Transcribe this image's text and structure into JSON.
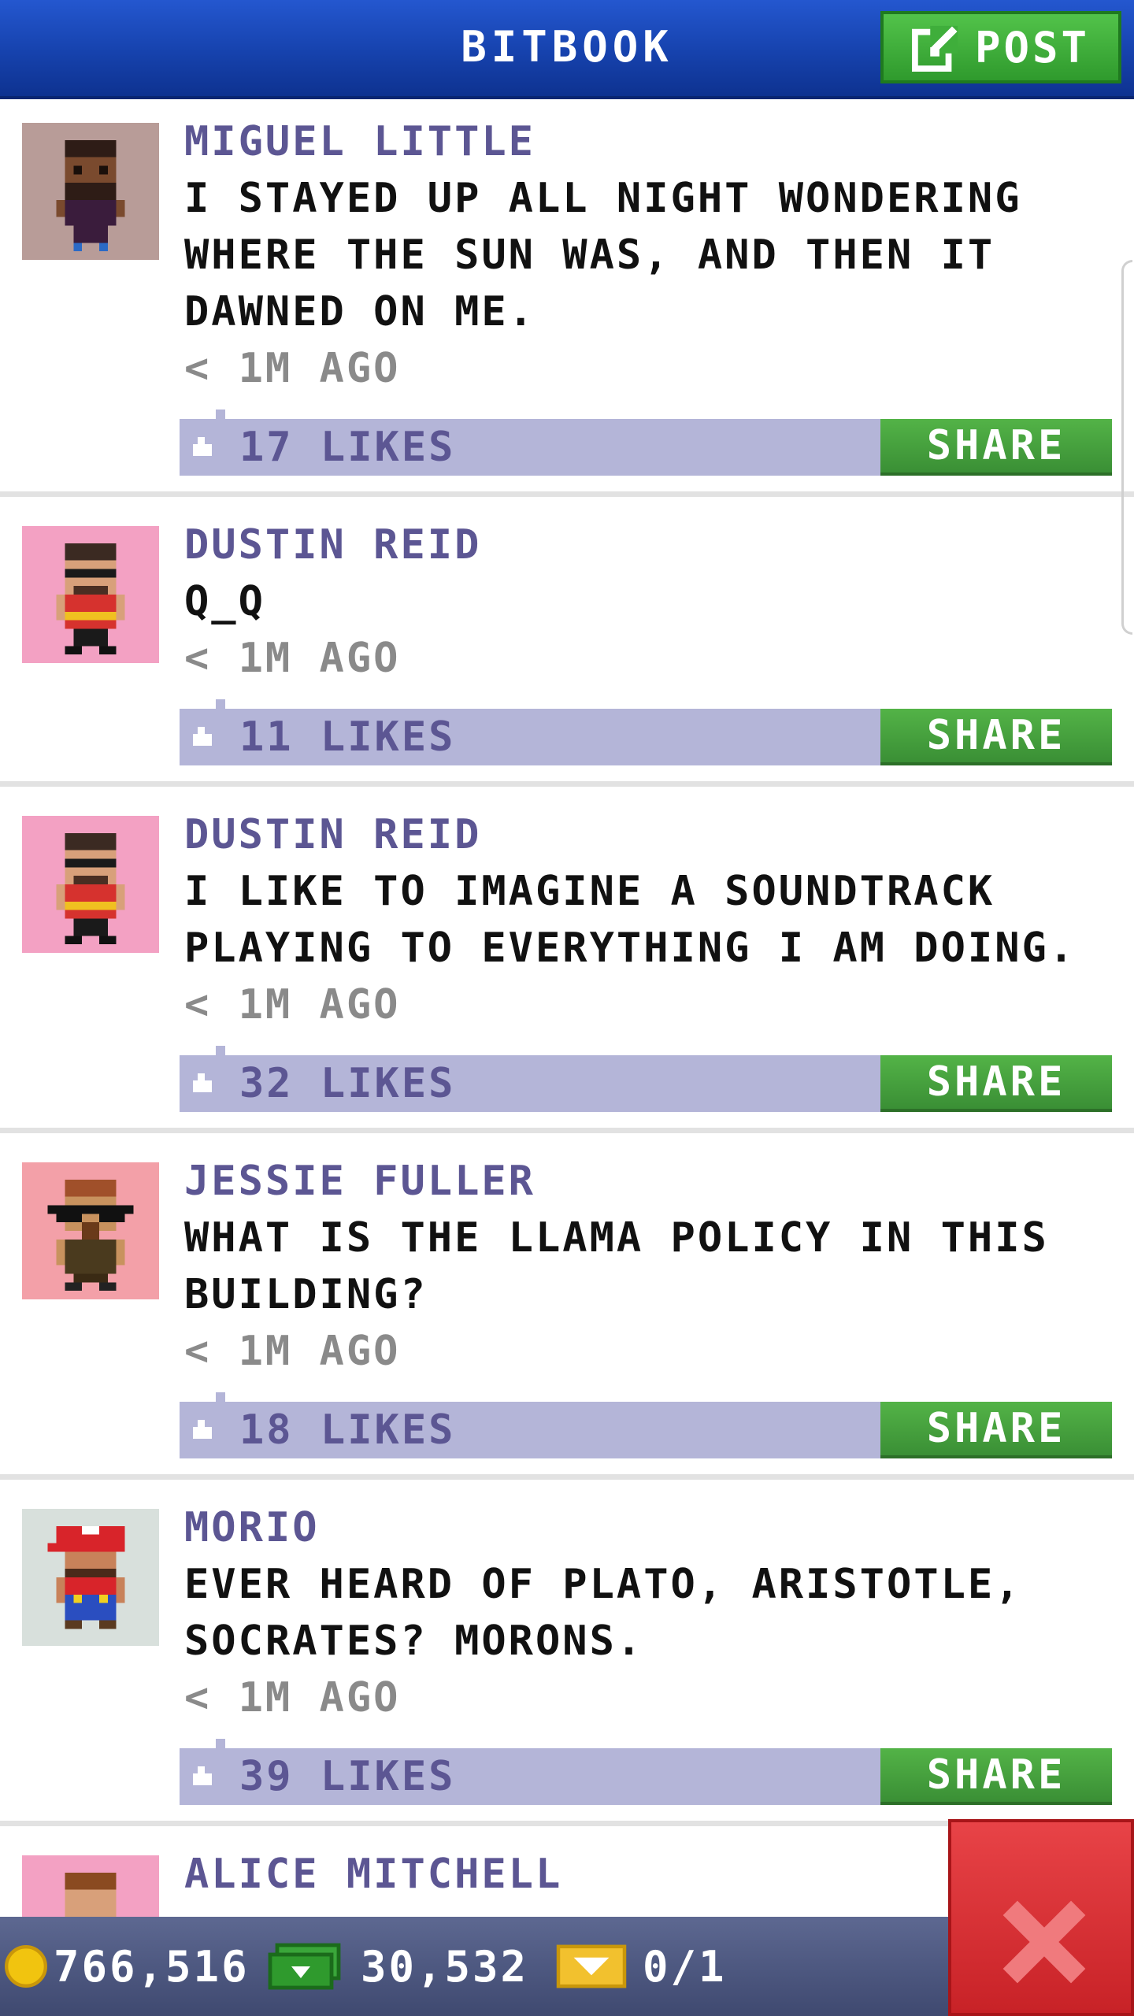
{
  "header": {
    "title": "BITBOOK",
    "post_label": "POST"
  },
  "posts": [
    {
      "author": "MIGUEL LITTLE",
      "message": "I STAYED UP ALL NIGHT WONDERING WHERE THE SUN WAS, AND THEN IT DAWNED ON ME.",
      "time": "< 1M AGO",
      "likes": "17 LIKES",
      "share": "SHARE",
      "avatar_bg": "#b89c98"
    },
    {
      "author": "DUSTIN REID",
      "message": "Q_Q",
      "time": "< 1M AGO",
      "likes": "11 LIKES",
      "share": "SHARE",
      "avatar_bg": "#f3a1c3"
    },
    {
      "author": "DUSTIN REID",
      "message": "I LIKE TO IMAGINE A SOUNDTRACK PLAYING TO EVERYTHING I AM DOING.",
      "time": "< 1M AGO",
      "likes": "32 LIKES",
      "share": "SHARE",
      "avatar_bg": "#f3a1c3"
    },
    {
      "author": "JESSIE FULLER",
      "message": "WHAT IS THE LLAMA POLICY IN THIS BUILDING?",
      "time": "< 1M AGO",
      "likes": "18 LIKES",
      "share": "SHARE",
      "avatar_bg": "#f3a0a8"
    },
    {
      "author": "MORIO",
      "message": "EVER HEARD OF PLATO, ARISTOTLE, SOCRATES? MORONS.",
      "time": "< 1M AGO",
      "likes": "39 LIKES",
      "share": "SHARE",
      "avatar_bg": "#d8e0dc"
    },
    {
      "author": "ALICE MITCHELL",
      "message": "",
      "time": "",
      "likes": "",
      "share": "",
      "avatar_bg": "#f3a1c3"
    }
  ],
  "bottom_bar": {
    "coins": "766,516",
    "bux": "30,532",
    "tickets": "0/1"
  },
  "icons": {
    "post": "edit-icon",
    "like": "thumbs-up-icon",
    "coins": "coin-icon",
    "bux": "bux-icon",
    "tickets": "ticket-icon",
    "close": "close-icon"
  },
  "colors": {
    "header": "#1642ad",
    "accent_green": "#3a8f35",
    "likes_bar": "#b4b5d8",
    "name_text": "#5c5693",
    "close_red": "#c82227"
  }
}
